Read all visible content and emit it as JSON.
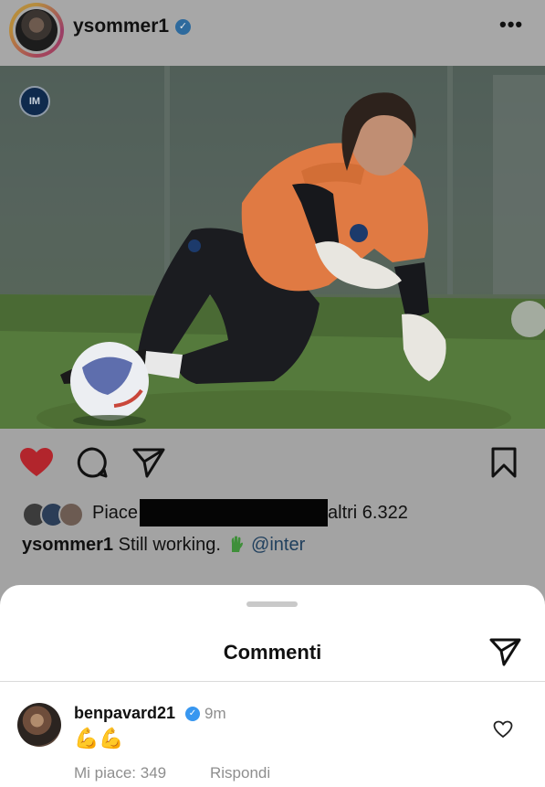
{
  "post": {
    "username": "ysommer1",
    "more_label": "•••",
    "club_badge": "IM"
  },
  "icons": {
    "verified": "✓",
    "like": "heart-icon",
    "comment": "comment-icon",
    "share": "send-icon",
    "save": "bookmark-icon",
    "glove": "glove-emoji",
    "flexed_biceps": "💪"
  },
  "likes": {
    "prefix": "Piace",
    "suffix": "altri 6.322"
  },
  "caption": {
    "username": "ysommer1",
    "text": "Still working.",
    "mention": "@inter"
  },
  "comments_sheet": {
    "title": "Commenti",
    "comment": {
      "username": "benpavard21",
      "time": "9m",
      "text": "💪💪",
      "likes_label": "Mi piace: 349",
      "reply_label": "Rispondi"
    }
  },
  "colors": {
    "like_red": "#b2252c",
    "verified_blue": "#3897f0",
    "goalkeeper_kit": "#e07a43",
    "overlay_gray": "#a3a3a3"
  }
}
